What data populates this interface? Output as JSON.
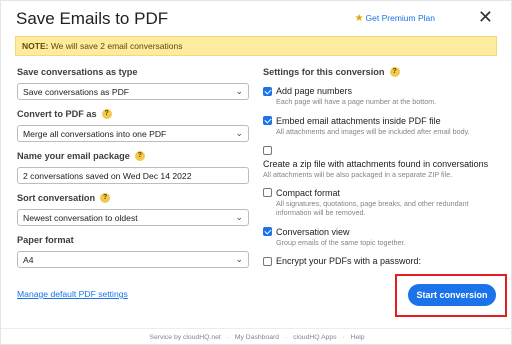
{
  "header": {
    "title": "Save Emails to PDF",
    "premium_label": "Get Premium Plan",
    "close_glyph": "✕"
  },
  "note": {
    "prefix": "NOTE:",
    "text": " We will save 2 email conversations"
  },
  "left": {
    "save_type": {
      "label": "Save conversations as type",
      "value": "Save conversations as PDF"
    },
    "convert": {
      "label": "Convert to PDF as",
      "value": "Merge all conversations into one PDF"
    },
    "package": {
      "label": "Name your email package",
      "value": "2 conversations saved on Wed Dec 14 2022"
    },
    "sort": {
      "label": "Sort conversation",
      "value": "Newest conversation to oldest"
    },
    "paper": {
      "label": "Paper format",
      "value": "A4"
    }
  },
  "right": {
    "title": "Settings for this conversion",
    "options": [
      {
        "label": "Add page numbers",
        "desc": "Each page will have a page number at the bottom.",
        "checked": true
      },
      {
        "label": "Embed email attachments inside PDF file",
        "desc": "All attachments and images will be included after email body.",
        "checked": true
      },
      {
        "label": "Create a zip file with attachments found in conversations",
        "desc": "All attachments will be also packaged in a separate ZIP file.",
        "checked": false
      },
      {
        "label": "Compact format",
        "desc": "All signatures, quotations, page breaks, and other redundant information will be removed.",
        "checked": false
      },
      {
        "label": "Conversation view",
        "desc": "Group emails of the same topic together.",
        "checked": true
      },
      {
        "label": "Encrypt your PDFs with a password:",
        "desc": "",
        "checked": false
      }
    ]
  },
  "actions": {
    "manage_label": "Manage default PDF settings",
    "start_label": "Start conversion"
  },
  "footer": {
    "service": "Service by cloudHQ.net",
    "dashboard": "My Dashboard",
    "apps": "cloudHQ Apps",
    "help": "Help",
    "separator": "·"
  },
  "colors": {
    "accent": "#1a73e8",
    "note_bg": "#fdeba0",
    "highlight": "#e31b23"
  }
}
